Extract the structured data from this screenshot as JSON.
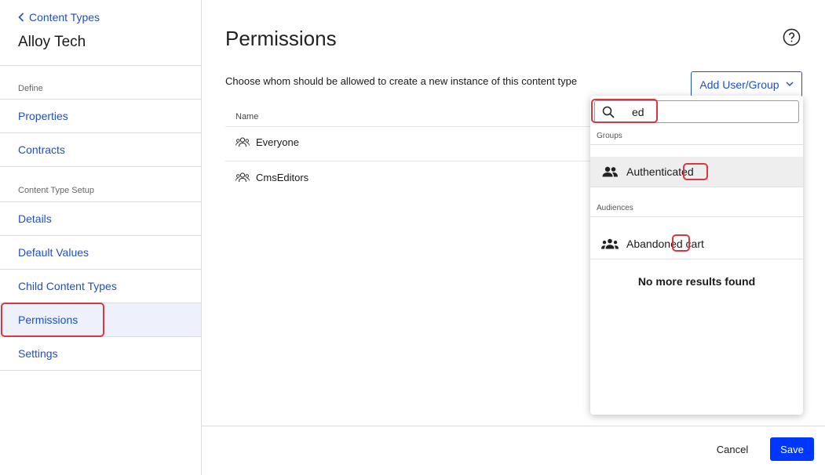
{
  "sidebar": {
    "back_label": "Content Types",
    "title": "Alloy Tech",
    "sections": {
      "define": "Define",
      "setup": "Content Type Setup"
    },
    "items": [
      {
        "label": "Properties"
      },
      {
        "label": "Contracts"
      },
      {
        "label": "Details"
      },
      {
        "label": "Default Values"
      },
      {
        "label": "Child Content Types"
      },
      {
        "label": "Permissions",
        "active": true
      },
      {
        "label": "Settings"
      }
    ]
  },
  "main": {
    "title": "Permissions",
    "description": "Choose whom should be allowed to create a new instance of this content type",
    "add_button": "Add User/Group",
    "column_name": "Name",
    "rows": [
      {
        "name": "Everyone"
      },
      {
        "name": "CmsEditors"
      }
    ]
  },
  "dropdown": {
    "search_value": "ed",
    "groups_label": "Groups",
    "group_item": {
      "prefix": "Authentica",
      "match": "ted"
    },
    "audiences_label": "Audiences",
    "audience_item": {
      "prefix": "Abandon",
      "match": "ed",
      "suffix": " cart"
    },
    "empty_text": "No more results found"
  },
  "footer": {
    "cancel": "Cancel",
    "save": "Save"
  },
  "colors": {
    "link": "#1f4fc4",
    "primary": "#0037ff",
    "highlight": "#d9363e"
  },
  "icons": [
    "chevron-left-icon",
    "help-icon",
    "chevron-down-icon",
    "user-group-icon",
    "search-icon",
    "group-icon",
    "audience-icon"
  ]
}
